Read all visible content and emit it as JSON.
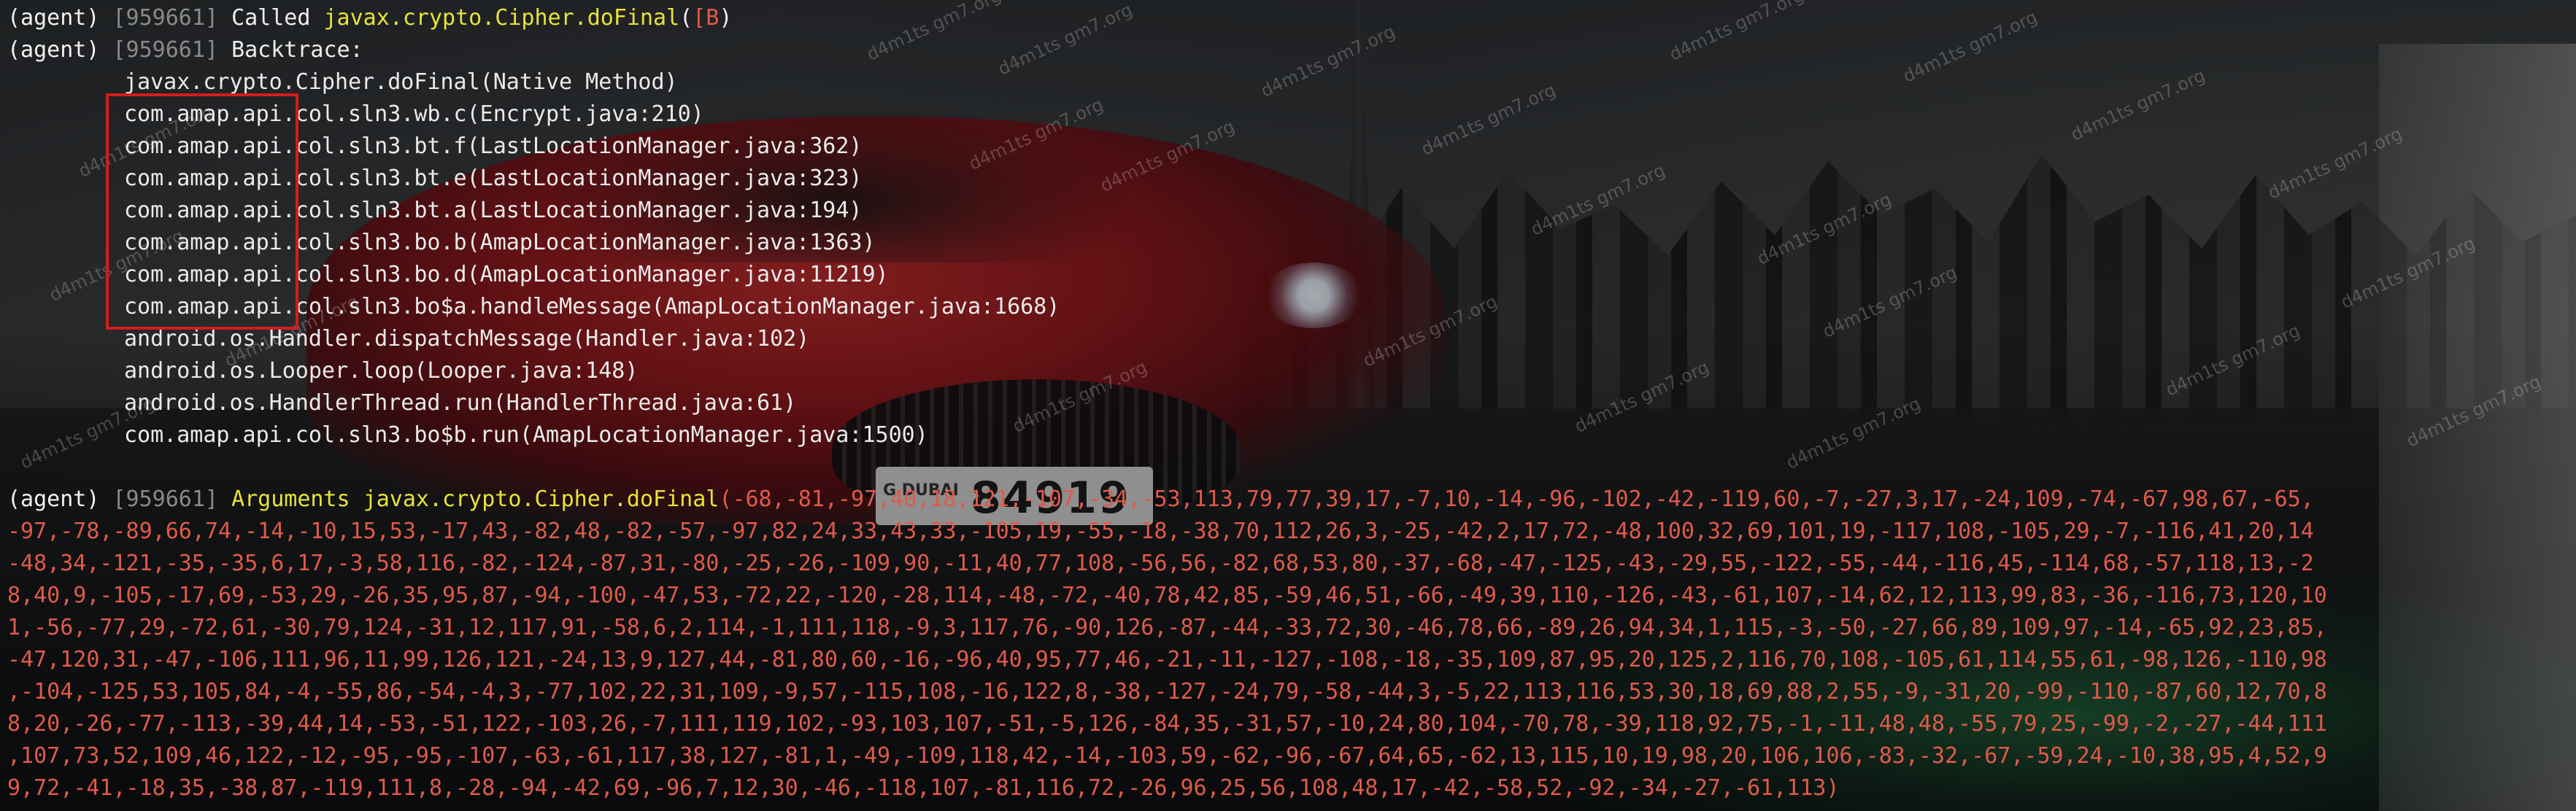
{
  "terminal": {
    "line1": {
      "prefix": "(agent) ",
      "pid": "[959661] ",
      "text": "Called ",
      "func": "javax.crypto.Cipher.doFinal",
      "paren_open": "(",
      "arg": "[B",
      "paren_close": ")"
    },
    "line2": {
      "prefix": "(agent) ",
      "pid": "[959661] ",
      "text": "Backtrace:"
    },
    "backtrace": [
      "javax.crypto.Cipher.doFinal(Native Method)",
      "com.amap.api.col.sln3.wb.c(Encrypt.java:210)",
      "com.amap.api.col.sln3.bt.f(LastLocationManager.java:362)",
      "com.amap.api.col.sln3.bt.e(LastLocationManager.java:323)",
      "com.amap.api.col.sln3.bt.a(LastLocationManager.java:194)",
      "com.amap.api.col.sln3.bo.b(AmapLocationManager.java:1363)",
      "com.amap.api.col.sln3.bo.d(AmapLocationManager.java:11219)",
      "com.amap.api.col.sln3.bo$a.handleMessage(AmapLocationManager.java:1668)",
      "android.os.Handler.dispatchMessage(Handler.java:102)",
      "android.os.Looper.loop(Looper.java:148)",
      "android.os.HandlerThread.run(HandlerThread.java:61)",
      "com.amap.api.col.sln3.bo$b.run(AmapLocationManager.java:1500)"
    ],
    "args_line": {
      "prefix": "(agent) ",
      "pid": "[959661] ",
      "text": "Arguments ",
      "func": "javax.crypto.Cipher.doFinal",
      "values_first": "(-68,-81,-97,40,18,121,-107,-34,-53,113,79,77,39,17,-7,10,-14,-96,-102,-42,-119,60,-7,-27,3,17,-24,109,-74,-67,98,67,-65,"
    },
    "args_values": [
      "-97,-78,-89,66,74,-14,-10,15,53,-17,43,-82,48,-82,-57,-97,82,24,33,43,33,-105,19,-55,-18,-38,70,112,26,3,-25,-42,2,17,72,-48,100,32,69,101,19,-117,108,-105,29,-7,-116,41,20,14",
      "-48,34,-121,-35,-35,6,17,-3,58,116,-82,-124,-87,31,-80,-25,-26,-109,90,-11,40,77,108,-56,56,-82,68,53,80,-37,-68,-47,-125,-43,-29,55,-122,-55,-44,-116,45,-114,68,-57,118,13,-2",
      "8,40,9,-105,-17,69,-53,29,-26,35,95,87,-94,-100,-47,53,-72,22,-120,-28,114,-48,-72,-40,78,42,85,-59,46,51,-66,-49,39,110,-126,-43,-61,107,-14,62,12,113,99,83,-36,-116,73,120,10",
      "1,-56,-77,29,-72,61,-30,79,124,-31,12,117,91,-58,6,2,114,-1,111,118,-9,3,117,76,-90,126,-87,-44,-33,72,30,-46,78,66,-89,26,94,34,1,115,-3,-50,-27,66,89,109,97,-14,-65,92,23,85,",
      "-47,120,31,-47,-106,111,96,11,99,126,121,-24,13,9,127,44,-81,80,60,-16,-96,40,95,77,46,-21,-11,-127,-108,-18,-35,109,87,95,20,125,2,116,70,108,-105,61,114,55,61,-98,126,-110,98",
      ",-104,-125,53,105,84,-4,-55,86,-54,-4,3,-77,102,22,31,109,-9,57,-115,108,-16,122,8,-38,-127,-24,79,-58,-44,3,-5,22,113,116,53,30,18,69,88,2,55,-9,-31,20,-99,-110,-87,60,12,70,8",
      "8,20,-26,-77,-113,-39,44,14,-53,-51,122,-103,26,-7,111,119,102,-93,103,107,-51,-5,126,-84,35,-31,57,-10,24,80,104,-70,78,-39,118,92,75,-1,-11,48,48,-55,79,25,-99,-2,-27,-44,111",
      ",107,73,52,109,46,122,-12,-95,-95,-107,-63,-61,117,38,127,-81,1,-49,-109,118,42,-14,-103,59,-62,-96,-67,64,65,-62,13,115,10,19,98,20,106,106,-83,-32,-67,-59,24,-10,38,95,4,52,9",
      "9,72,-41,-18,35,-38,87,-119,111,8,-28,-94,-42,69,-96,7,12,30,-46,-118,107,-81,116,72,-26,96,25,56,108,48,17,-42,-58,52,-92,-34,-27,-61,113)"
    ]
  },
  "background": {
    "watermark": "d4m1ts gm7.org",
    "plate_number": "84919",
    "plate_text": "G DUBAI"
  },
  "colors": {
    "function_highlight": "#e8e23a",
    "pid": "#8a8a8a",
    "arguments": "#e05a4a",
    "box_border": "#d21d1d"
  }
}
